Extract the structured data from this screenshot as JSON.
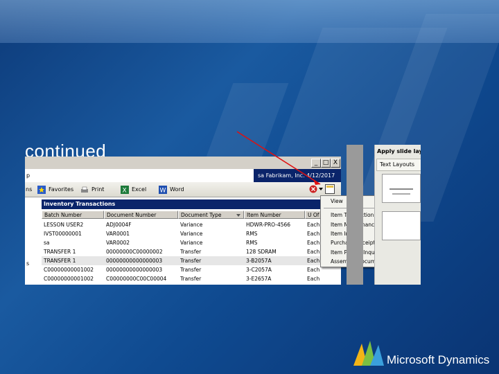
{
  "slide": {
    "continued_text": "continued",
    "brand_name": "Microsoft Dynamics"
  },
  "window": {
    "left_label": "p",
    "user_info": "sa  Fabrikam, Inc.  4/12/2017",
    "buttons": [
      "_",
      "□",
      "X"
    ]
  },
  "toolbar": {
    "items": [
      {
        "label": "ns",
        "icon": "none"
      },
      {
        "label": "Favorites",
        "icon": "star-icon"
      },
      {
        "label": "Print",
        "icon": "printer-icon"
      },
      {
        "label": "Excel",
        "icon": "excel-icon"
      },
      {
        "label": "Word",
        "icon": "word-icon"
      }
    ]
  },
  "grid": {
    "title": "Inventory Transactions",
    "columns": [
      "Batch Number",
      "Document Number",
      "Document Type",
      "Item Number",
      "U Of"
    ],
    "rows": [
      [
        "LESSON USER2",
        "ADJ0004F",
        "Variance",
        "HDWR-PRO-4566",
        "Each"
      ],
      [
        "IVST00000001",
        "VAR0001",
        "Variance",
        "RMS",
        "Each"
      ],
      [
        "sa",
        "VAR0002",
        "Variance",
        "RMS",
        "Each"
      ],
      [
        "TRANSFER 1",
        "00000000C00000002",
        "Transfer",
        "128 SDRAM",
        "Each"
      ],
      [
        "TRANSFER 1",
        "00000000000000003",
        "Transfer",
        "3-B2057A",
        "Each"
      ],
      [
        "C00000000001002",
        "00000000000000003",
        "Transfer",
        "3-C2057A",
        "Each"
      ],
      [
        "C00000000001002",
        "C00000000C00C00004",
        "Transfer",
        "3-E2657A",
        "Each"
      ]
    ],
    "selected_row": 4
  },
  "context_menu": {
    "items": [
      "View",
      "Item Transaction Inquiry",
      "Item Maintenance",
      "Item Inquiry",
      "Purchase Receipts Inquiry",
      "Item Pricing Inquiry",
      "Assembly Document Inquiry"
    ]
  },
  "side_panel": {
    "title": "Apply slide lay",
    "section": "Text Layouts"
  },
  "colors": {
    "background": "#0f4a90",
    "window_title": "#0a246a",
    "arrow": "#e01010"
  }
}
